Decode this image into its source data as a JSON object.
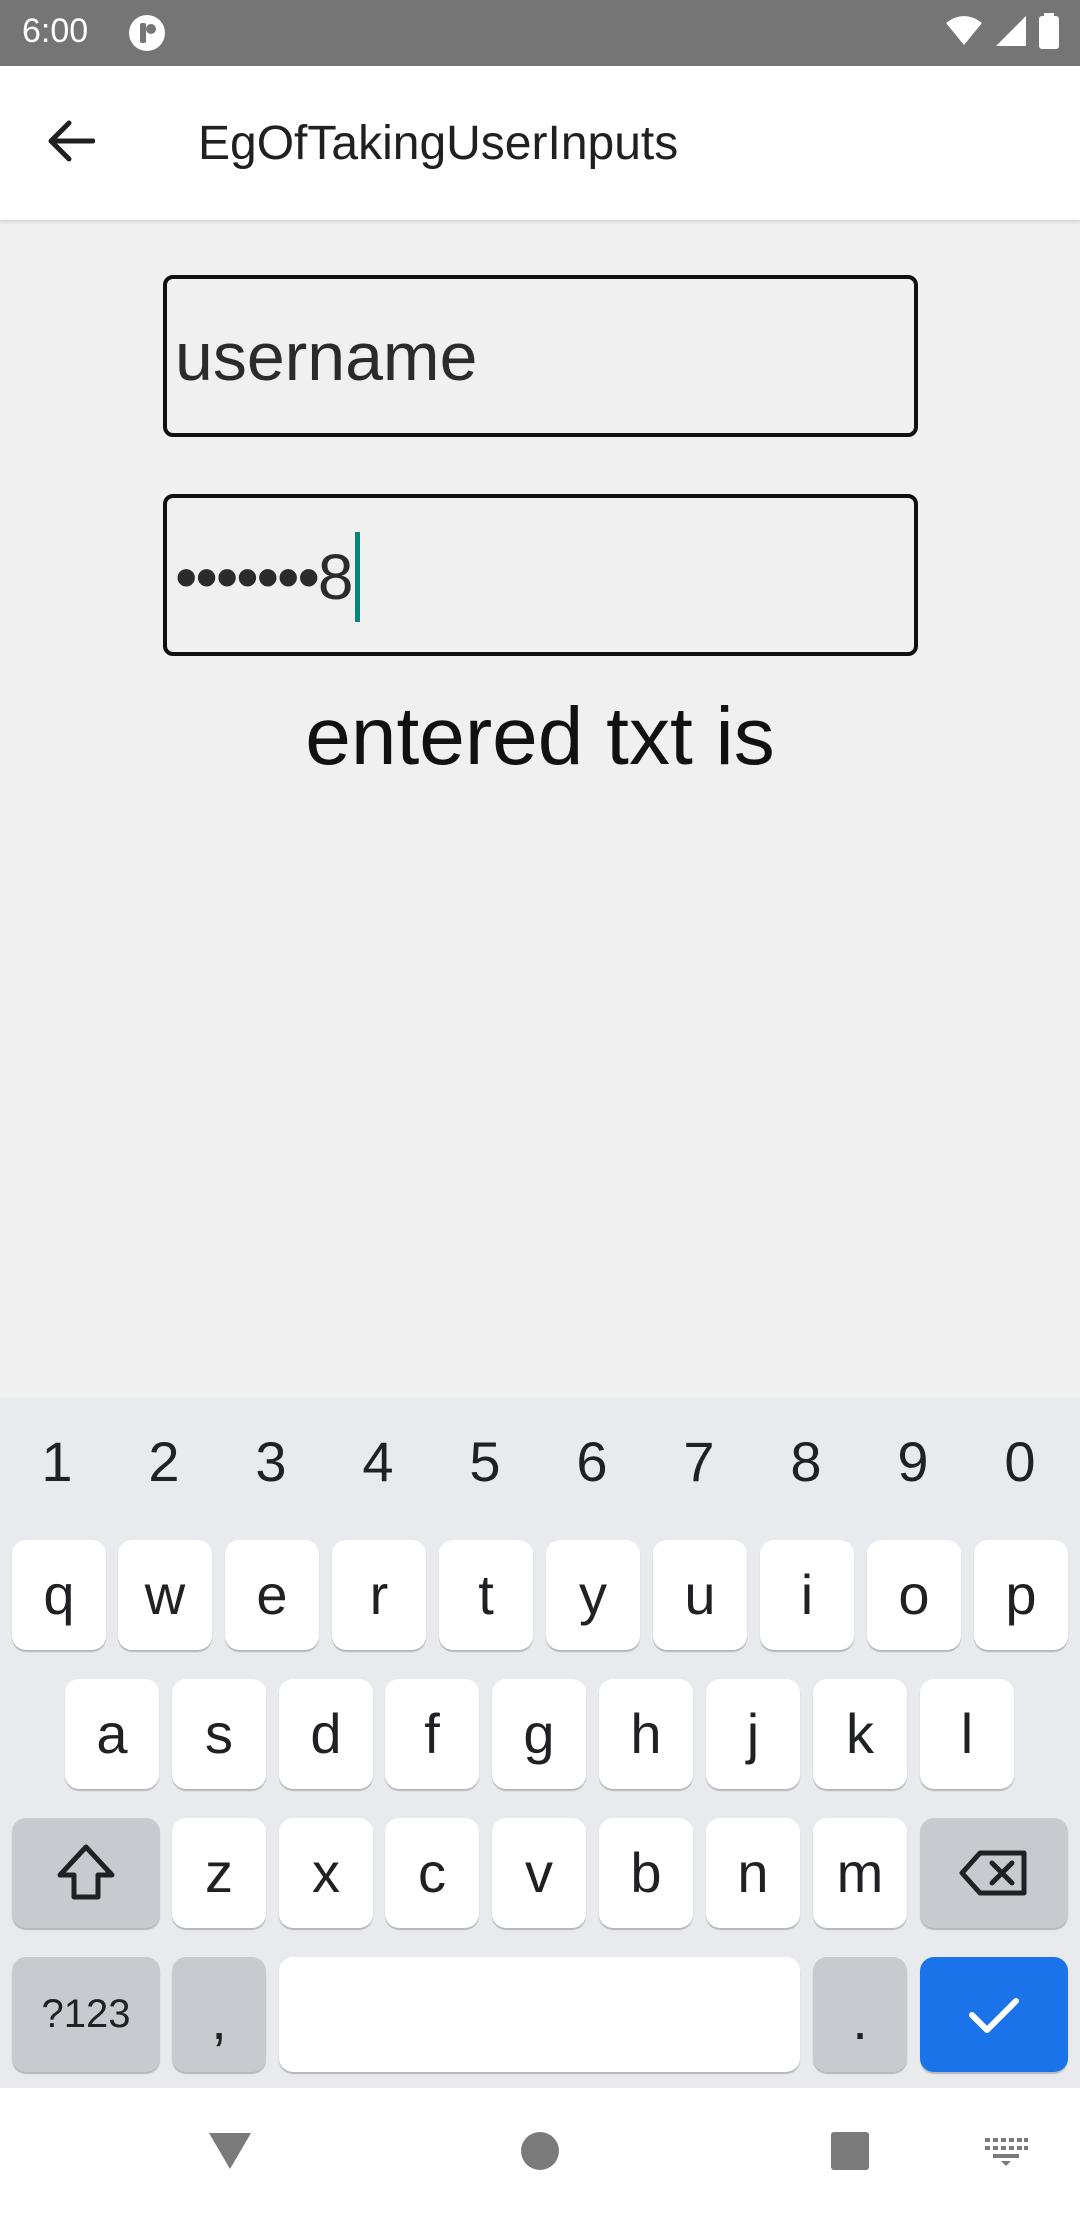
{
  "status_bar": {
    "time": "6:00",
    "icons": [
      "app-notification-icon",
      "wifi-icon",
      "cell-signal-icon",
      "battery-icon"
    ]
  },
  "app_bar": {
    "title": "EgOfTakingUserInputs",
    "back_icon": "back-arrow-icon"
  },
  "form": {
    "username_value": "username",
    "password_masked": "•••••••",
    "password_last_char": "8",
    "entered_text_label": "entered txt is"
  },
  "keyboard": {
    "number_row": [
      "1",
      "2",
      "3",
      "4",
      "5",
      "6",
      "7",
      "8",
      "9",
      "0"
    ],
    "row1": [
      "q",
      "w",
      "e",
      "r",
      "t",
      "y",
      "u",
      "i",
      "o",
      "p"
    ],
    "row2": [
      "a",
      "s",
      "d",
      "f",
      "g",
      "h",
      "j",
      "k",
      "l"
    ],
    "row3": [
      "z",
      "x",
      "c",
      "v",
      "b",
      "n",
      "m"
    ],
    "symbols_label": "?123",
    "comma_label": ",",
    "period_label": ".",
    "shift_icon": "shift-icon",
    "backspace_icon": "backspace-icon",
    "enter_icon": "checkmark-icon",
    "colors": {
      "action": "#1a73e8",
      "function_key": "#c7cacf",
      "key": "#ffffff",
      "background": "#e8eaed"
    }
  },
  "nav_bar": {
    "icons": [
      "back-triangle-icon",
      "home-circle-icon",
      "recents-square-icon",
      "keyboard-switch-icon"
    ]
  },
  "colors": {
    "status_bar": "#757575",
    "caret": "#00897b",
    "page_background": "#f0f0f0"
  }
}
